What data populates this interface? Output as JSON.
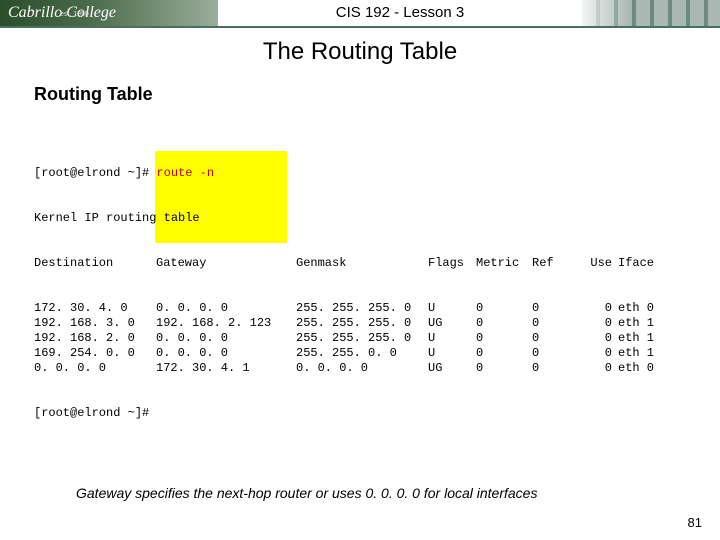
{
  "header": {
    "logo_text": "Cabrillo College",
    "logo_est": "est. 1959",
    "title": "CIS 192 - Lesson 3"
  },
  "page_title": "The Routing Table",
  "section_heading": "Routing Table",
  "terminal": {
    "prompt1": "[root@elrond ~]# ",
    "command": "route -n",
    "line2": "Kernel IP routing table",
    "headers": {
      "dest": "Destination",
      "gw": "Gateway",
      "mask": "Genmask",
      "flags": "Flags",
      "metric": "Metric",
      "ref": "Ref",
      "use": "Use",
      "iface": "Iface"
    },
    "rows": [
      {
        "dest": "172. 30. 4. 0",
        "gw": "0. 0. 0. 0",
        "mask": "255. 255. 255. 0",
        "flags": "U",
        "metric": "0",
        "ref": "0",
        "use": "0",
        "iface": "eth 0"
      },
      {
        "dest": "192. 168. 3. 0",
        "gw": "192. 168. 2. 123",
        "mask": "255. 255. 255. 0",
        "flags": "UG",
        "metric": "0",
        "ref": "0",
        "use": "0",
        "iface": "eth 1"
      },
      {
        "dest": "192. 168. 2. 0",
        "gw": "0. 0. 0. 0",
        "mask": "255. 255. 255. 0",
        "flags": "U",
        "metric": "0",
        "ref": "0",
        "use": "0",
        "iface": "eth 1"
      },
      {
        "dest": "169. 254. 0. 0",
        "gw": "0. 0. 0. 0",
        "mask": "255. 255. 0. 0",
        "flags": "U",
        "metric": "0",
        "ref": "0",
        "use": "0",
        "iface": "eth 1"
      },
      {
        "dest": "0. 0. 0. 0",
        "gw": "172. 30. 4. 1",
        "mask": "0. 0. 0. 0",
        "flags": "UG",
        "metric": "0",
        "ref": "0",
        "use": "0",
        "iface": "eth 0"
      }
    ],
    "prompt2": "[root@elrond ~]#"
  },
  "caption": "Gateway specifies the next-hop router or uses 0. 0. 0. 0 for local interfaces",
  "page_number": "81"
}
